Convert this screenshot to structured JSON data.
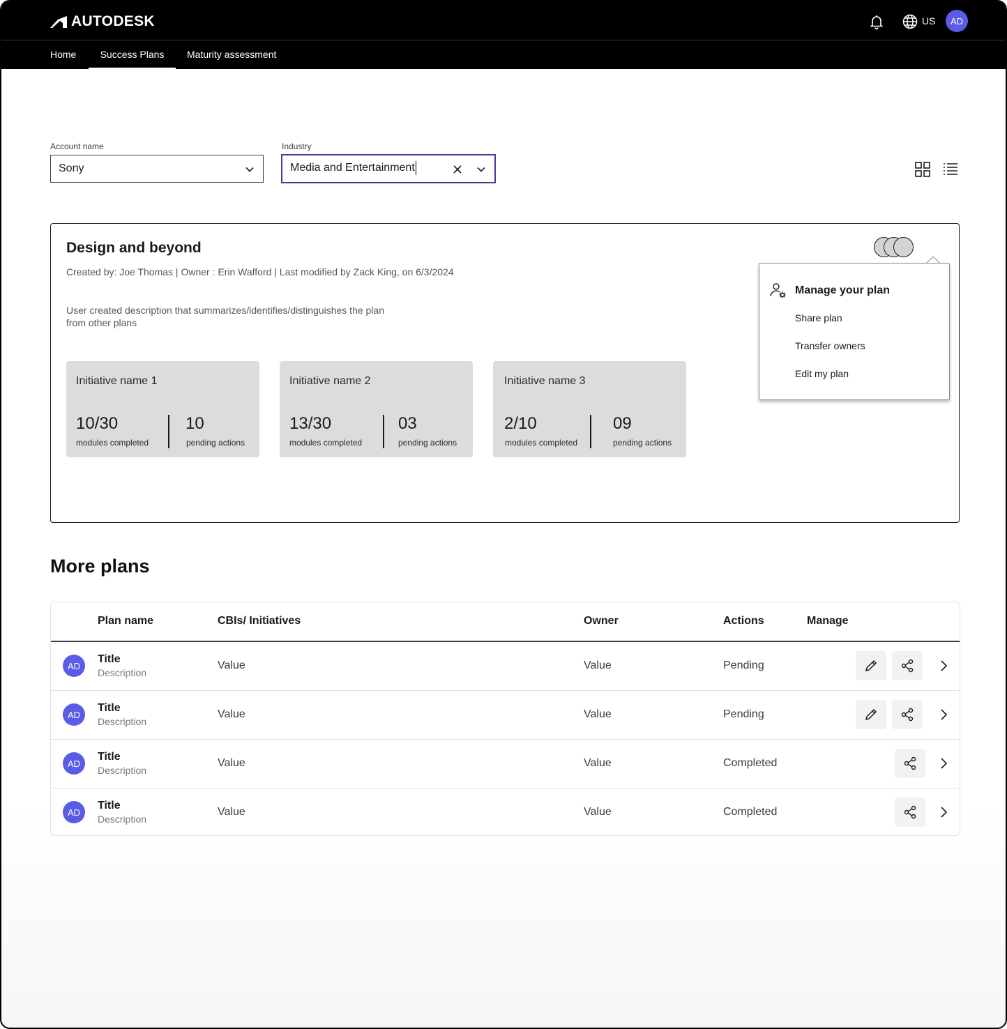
{
  "header": {
    "brand": "AUTODESK",
    "locale": "US",
    "user_initials": "AD",
    "nav": [
      {
        "label": "Home"
      },
      {
        "label": "Success Plans"
      },
      {
        "label": "Maturity assessment"
      }
    ],
    "active_nav": "Success Plans"
  },
  "filters": {
    "account": {
      "label": "Account name",
      "value": "Sony"
    },
    "industry": {
      "label": "Industry",
      "value": "Media and Entertainment"
    }
  },
  "view_toggle": {
    "icons": [
      "grid-view-icon",
      "list-view-icon"
    ]
  },
  "featured_plan": {
    "title": "Design and beyond",
    "meta": "Created by: Joe Thomas | Owner : Erin Wafford | Last modified by Zack King, on 6/3/2024",
    "description": "User created description that summarizes/identifies/distinguishes the plan from other plans",
    "initiatives": [
      {
        "name": "Initiative name 1",
        "modules": "10/30",
        "modules_label": "modules completed",
        "pending": "10",
        "pending_label": "pending actions"
      },
      {
        "name": "Initiative name 2",
        "modules": "13/30",
        "modules_label": "modules completed",
        "pending": "03",
        "pending_label": "pending actions"
      },
      {
        "name": "Initiative name 3",
        "modules": "2/10",
        "modules_label": "modules completed",
        "pending": "09",
        "pending_label": "pending actions"
      }
    ],
    "manage_menu": {
      "heading": "Manage your plan",
      "items": [
        {
          "label": "Share plan"
        },
        {
          "label": "Transfer owners"
        },
        {
          "label": "Edit my plan"
        }
      ]
    }
  },
  "more_plans": {
    "title": "More plans",
    "columns": [
      "Plan name",
      "CBIs/ Initiatives",
      "Owner",
      "Actions",
      "Manage"
    ],
    "rows": [
      {
        "initials": "AD",
        "title": "Title",
        "description": "Description",
        "initiatives": "Value",
        "owner": "Value",
        "actions": "Pending",
        "editable": true
      },
      {
        "initials": "AD",
        "title": "Title",
        "description": "Description",
        "initiatives": "Value",
        "owner": "Value",
        "actions": "Pending",
        "editable": true
      },
      {
        "initials": "AD",
        "title": "Title",
        "description": "Description",
        "initiatives": "Value",
        "owner": "Value",
        "actions": "Completed",
        "editable": false
      },
      {
        "initials": "AD",
        "title": "Title",
        "description": "Description",
        "initiatives": "Value",
        "owner": "Value",
        "actions": "Completed",
        "editable": false
      }
    ]
  },
  "colors": {
    "header_bg": "#000000",
    "avatar": "#5b5ce6",
    "focus_border": "#3d3d9c",
    "initiative_bg": "#dcdcdc"
  }
}
